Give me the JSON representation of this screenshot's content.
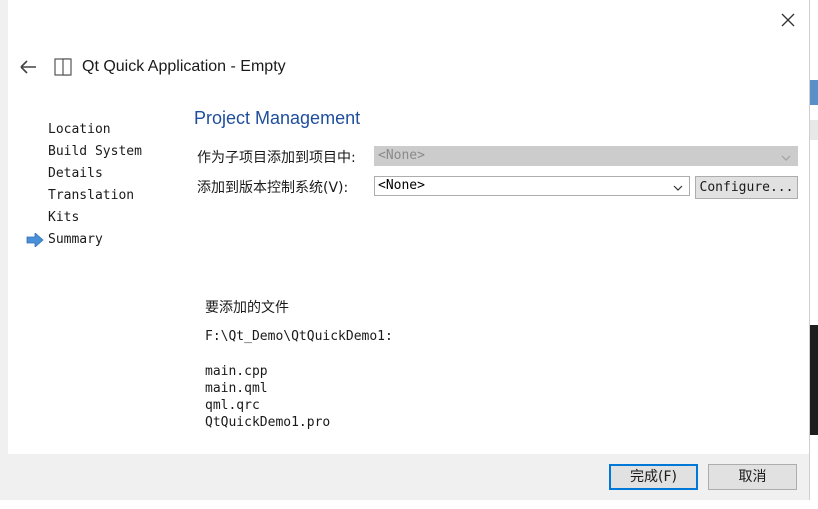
{
  "wizard": {
    "title": "Qt Quick Application - Empty",
    "icons": {
      "back": "back-arrow-icon",
      "wizard": "wizard-page-icon",
      "close": "close-icon"
    }
  },
  "steps": [
    {
      "label": "Location",
      "current": false
    },
    {
      "label": "Build System",
      "current": false
    },
    {
      "label": "Details",
      "current": false
    },
    {
      "label": "Translation",
      "current": false
    },
    {
      "label": "Kits",
      "current": false
    },
    {
      "label": "Summary",
      "current": true
    }
  ],
  "page": {
    "heading": "Project Management",
    "add_subproject_label": "作为子项目添加到项目中:",
    "add_subproject_value": "<None>",
    "vcs_label": "添加到版本控制系统(V):",
    "vcs_value": "<None>",
    "configure_label": "Configure...",
    "files_heading": "要添加的文件",
    "files_dir": "F:\\Qt_Demo\\QtQuickDemo1:",
    "files": [
      "main.cpp",
      "main.qml",
      "qml.qrc",
      "QtQuickDemo1.pro"
    ]
  },
  "footer": {
    "finish_label": "完成(F)",
    "cancel_label": "取消"
  },
  "colors": {
    "heading": "#1f4e9c",
    "accent": "#0078d7",
    "current_step_arrow": "#4a90d9"
  }
}
